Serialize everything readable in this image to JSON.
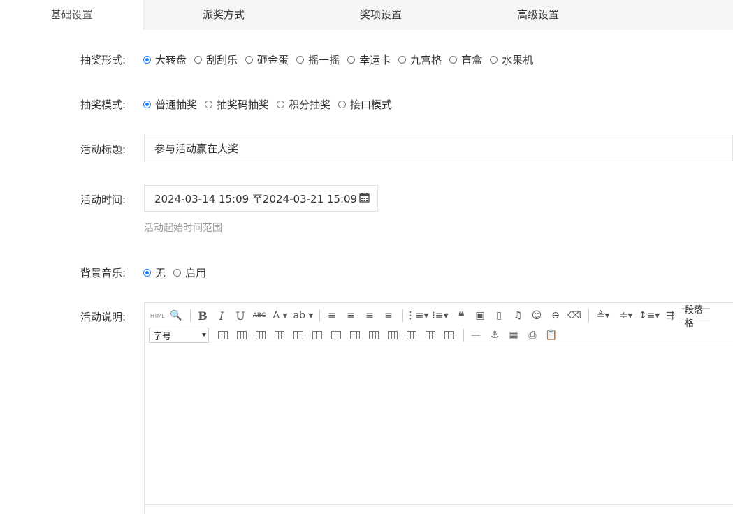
{
  "tabs": [
    {
      "label": "基础设置",
      "active": true
    },
    {
      "label": "派奖方式",
      "active": false
    },
    {
      "label": "奖项设置",
      "active": false
    },
    {
      "label": "高级设置",
      "active": false
    }
  ],
  "lottery_form": {
    "label": "抽奖形式:",
    "options": [
      "大转盘",
      "刮刮乐",
      "砸金蛋",
      "摇一摇",
      "幸运卡",
      "九宫格",
      "盲盒",
      "水果机"
    ],
    "selected": "大转盘"
  },
  "lottery_mode": {
    "label": "抽奖模式:",
    "options": [
      "普通抽奖",
      "抽奖码抽奖",
      "积分抽奖",
      "接口模式"
    ],
    "selected": "普通抽奖"
  },
  "activity_title": {
    "label": "活动标题:",
    "value": "参与活动赢在大奖"
  },
  "activity_time": {
    "label": "活动时间:",
    "value": "2024-03-14 15:09 至2024-03-21 15:09",
    "hint": "活动起始时间范围"
  },
  "bg_music": {
    "label": "背景音乐:",
    "options": [
      "无",
      "启用"
    ],
    "selected": "无"
  },
  "description": {
    "label": "活动说明:",
    "toolbar": {
      "html_label": "HTML",
      "font_size_label": "字号",
      "paragraph_label": "段落格"
    }
  },
  "colors": {
    "accent": "#1e80ff",
    "tab_bg": "#f5f5f5",
    "hint": "#999999"
  }
}
